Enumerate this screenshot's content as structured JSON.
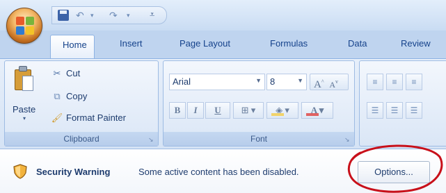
{
  "quick_access": {
    "undo_glyph": "↶",
    "redo_glyph": "↷",
    "dropdown_glyph": "▾",
    "customize_glyph": "⩡"
  },
  "tabs": [
    {
      "label": "Home",
      "active": true
    },
    {
      "label": "Insert"
    },
    {
      "label": "Page Layout"
    },
    {
      "label": "Formulas"
    },
    {
      "label": "Data"
    },
    {
      "label": "Review"
    }
  ],
  "clipboard": {
    "label": "Clipboard",
    "paste": "Paste",
    "cut": "Cut",
    "copy": "Copy",
    "format_painter": "Format Painter"
  },
  "font": {
    "label": "Font",
    "name": "Arial",
    "size": "8",
    "bold": "B",
    "italic": "I",
    "underline": "U",
    "grow": "A",
    "shrink": "A",
    "fill_glyph": "◈",
    "color_glyph": "A"
  },
  "security": {
    "title": "Security Warning",
    "message": "Some active content has been disabled.",
    "options": "Options..."
  },
  "colors": {
    "ribbon_blue": "#bfd4ef",
    "text_blue": "#1e3c6e",
    "annotation_red": "#c8101a"
  }
}
